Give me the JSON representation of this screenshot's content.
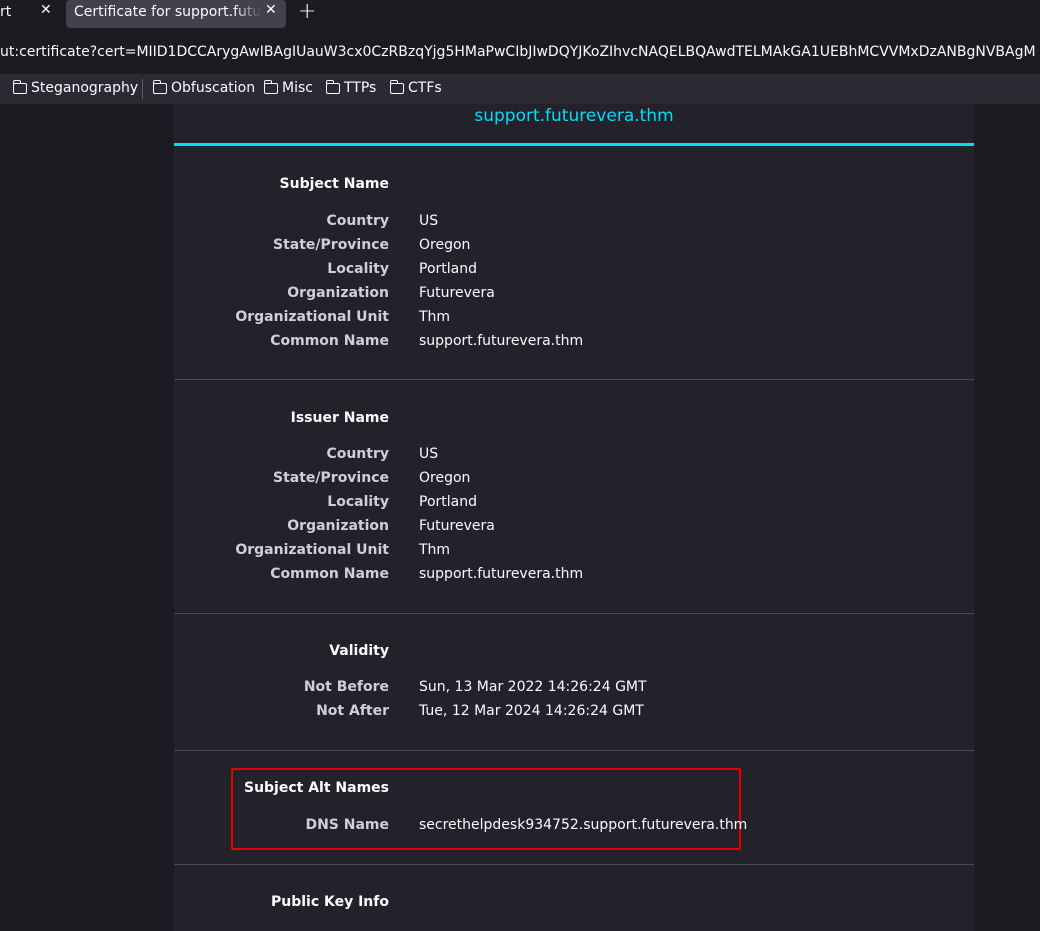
{
  "tabs": [
    {
      "label": "rt"
    },
    {
      "label": "Certificate for support.futurevera.thm"
    }
  ],
  "url": "ut:certificate?cert=MIID1DCCArygAwIBAgIUauW3cx0CzRBzqYjg5HMaPwCIbJIwDQYJKoZIhvcNAQELBQAwdTELMAkGA1UEBhMCVVMxDzANBgNVBAgM",
  "bookmarks": [
    {
      "label": "Steganography"
    },
    {
      "label": "Obfuscation"
    },
    {
      "label": "Misc"
    },
    {
      "label": "TTPs"
    },
    {
      "label": "CTFs"
    }
  ],
  "certificate": {
    "hostname": "support.futurevera.thm",
    "subject": {
      "title": "Subject Name",
      "fields": [
        {
          "key": "Country",
          "value": "US"
        },
        {
          "key": "State/Province",
          "value": "Oregon"
        },
        {
          "key": "Locality",
          "value": "Portland"
        },
        {
          "key": "Organization",
          "value": "Futurevera"
        },
        {
          "key": "Organizational Unit",
          "value": "Thm"
        },
        {
          "key": "Common Name",
          "value": "support.futurevera.thm"
        }
      ]
    },
    "issuer": {
      "title": "Issuer Name",
      "fields": [
        {
          "key": "Country",
          "value": "US"
        },
        {
          "key": "State/Province",
          "value": "Oregon"
        },
        {
          "key": "Locality",
          "value": "Portland"
        },
        {
          "key": "Organization",
          "value": "Futurevera"
        },
        {
          "key": "Organizational Unit",
          "value": "Thm"
        },
        {
          "key": "Common Name",
          "value": "support.futurevera.thm"
        }
      ]
    },
    "validity": {
      "title": "Validity",
      "fields": [
        {
          "key": "Not Before",
          "value": "Sun, 13 Mar 2022 14:26:24 GMT"
        },
        {
          "key": "Not After",
          "value": "Tue, 12 Mar 2024 14:26:24 GMT"
        }
      ]
    },
    "san": {
      "title": "Subject Alt Names",
      "fields": [
        {
          "key": "DNS Name",
          "value": "secrethelpdesk934752.support.futurevera.thm"
        }
      ]
    },
    "pubkey": {
      "title": "Public Key Info"
    }
  },
  "colors": {
    "accent": "#00ddff",
    "highlight": "#e60000"
  }
}
